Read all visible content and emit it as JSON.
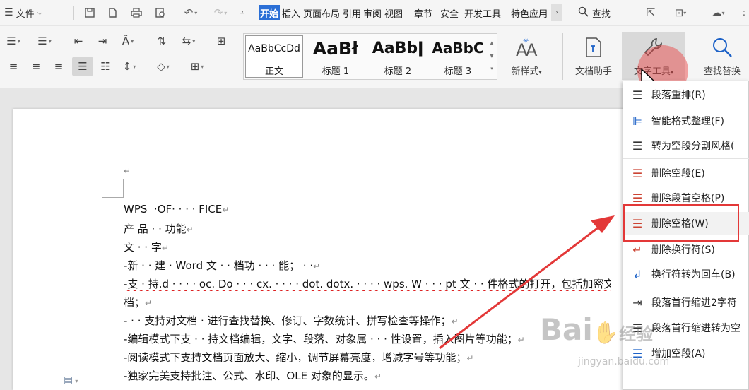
{
  "menubar": {
    "hamburger_icon": "menu-icon",
    "file_label": "文件",
    "tabs": [
      "开始",
      "插入",
      "页面布局",
      "引用",
      "审阅",
      "视图",
      "章节",
      "安全",
      "开发工具",
      "特色应用"
    ],
    "active_tab": "开始",
    "search_label": "查找"
  },
  "ribbon": {
    "styles": [
      {
        "preview": "AaBbCcDd",
        "name": "正文"
      },
      {
        "preview": "AaBł",
        "name": "标题 1"
      },
      {
        "preview": "AaBbǀ",
        "name": "标题 2"
      },
      {
        "preview": "AaBbC",
        "name": "标题 3"
      }
    ],
    "new_style_label": "新样式",
    "new_style_preview": "A̤A",
    "doc_assistant_label": "文档助手",
    "text_tools_label": "文字工具",
    "find_replace_label": "查找替换"
  },
  "document": {
    "lines": [
      "↵",
      "WPS  ·OF· · · · FICE",
      "产 品 · · 功能",
      "文 · · 字",
      "-新 · · 建 · Word 文 · · 档功 · · · 能； · ·",
      "-支 · 持.d · · · · oc. Do · · · cx. · · · · dot. dotx. · · · · wps. W · · · pt 文 · · 件格式的打开，包括加密文",
      "档；",
      "- · · 支持对文档 · 进行查找替换、修订、字数统计、拼写检查等操作；",
      "-编辑模式下支 · · 持文档编辑，文字、段落、对象属 · · · 性设置，插入图片等功能；",
      "-阅读模式下支持文档页面放大、缩小，调节屏幕亮度，增减字号等功能；",
      "-独家完美支持批注、公式、水印、OLE 对象的显示。"
    ]
  },
  "dropdown": {
    "items": [
      {
        "label": "段落重排(R)",
        "icon": "paragraph-rearrange-icon"
      },
      {
        "label": "智能格式整理(F)",
        "icon": "smart-format-icon"
      },
      {
        "label": "转为空段分割风格(",
        "icon": "empty-paragraph-style-icon"
      },
      {
        "label": "删除空段(E)",
        "icon": "delete-empty-paragraph-icon"
      },
      {
        "label": "删除段首空格(P)",
        "icon": "delete-leading-space-icon"
      },
      {
        "label": "删除空格(W)",
        "icon": "delete-space-icon"
      },
      {
        "label": "删除换行符(S)",
        "icon": "delete-line-break-icon"
      },
      {
        "label": "换行符转为回车(B)",
        "icon": "line-break-to-enter-icon"
      },
      {
        "label": "段落首行缩进2字符",
        "icon": "first-line-indent-icon"
      },
      {
        "label": "段落首行缩进转为空",
        "icon": "indent-to-space-icon"
      },
      {
        "label": "增加空段(A)",
        "icon": "add-empty-paragraph-icon"
      }
    ],
    "highlighted_item": "删除空格(W)"
  },
  "watermark": {
    "brand": "Bai",
    "brand_suffix": "经验",
    "url": "jingyan.baidu.com"
  },
  "colors": {
    "accent": "#2b6fd6",
    "highlight_red": "#e33838"
  }
}
